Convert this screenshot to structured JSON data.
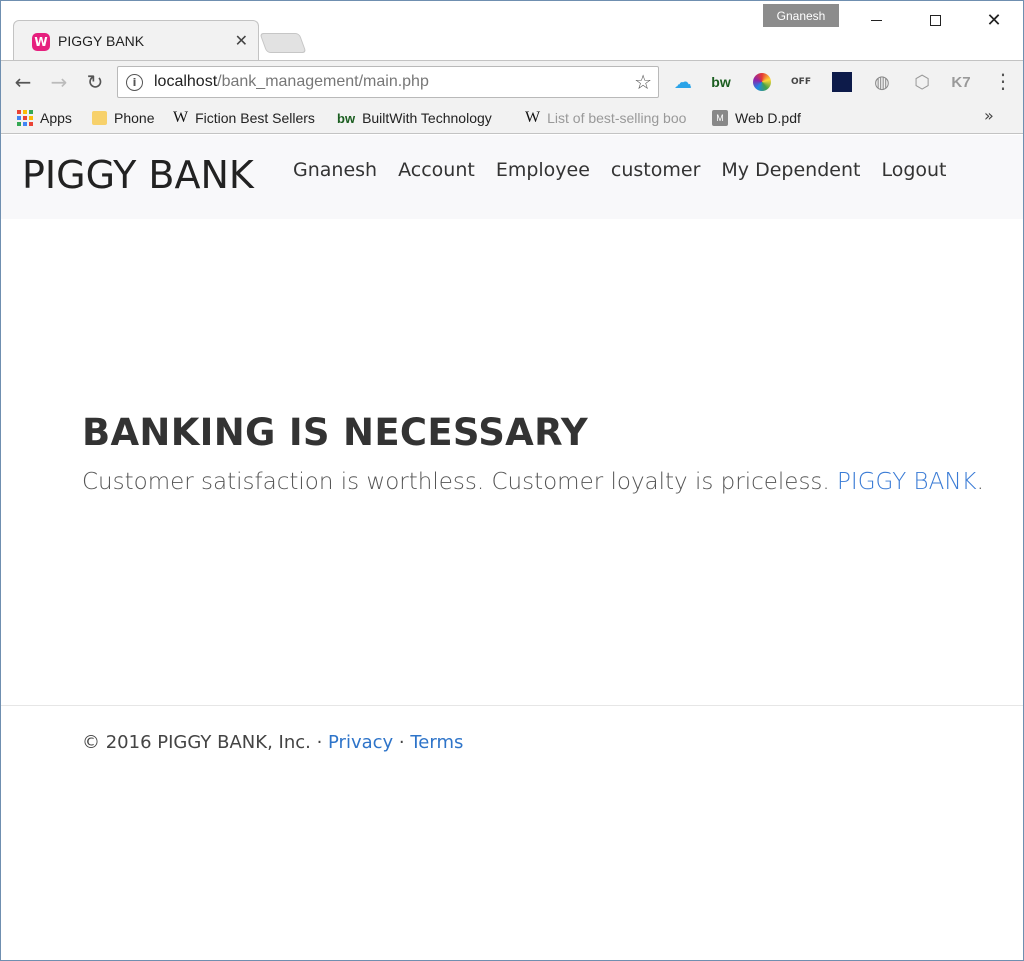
{
  "browser": {
    "tab_title": "PIGGY BANK",
    "profile_name": "Gnanesh",
    "url_host": "localhost",
    "url_path": "/bank_management/main.php",
    "extensions": {
      "bw": "bw",
      "off": "OFF",
      "k7": "K7"
    },
    "bookmarks": [
      {
        "label": "Apps"
      },
      {
        "label": "Phone"
      },
      {
        "label": "Fiction Best Sellers"
      },
      {
        "label": "BuiltWith Technology"
      },
      {
        "label": "List of best-selling boo"
      },
      {
        "label": "Web D.pdf"
      }
    ]
  },
  "site": {
    "brand": "PIGGY BANK",
    "nav": [
      {
        "label": "Gnanesh"
      },
      {
        "label": "Account"
      },
      {
        "label": "Employee"
      },
      {
        "label": "customer"
      },
      {
        "label": "My Dependent"
      },
      {
        "label": "Logout"
      }
    ],
    "hero": {
      "title": "BANKING IS NECESSARY",
      "subtitle_text": "Customer satisfaction is worthless. Customer loyalty is priceless. ",
      "subtitle_link": "PIGGY BANK",
      "subtitle_end": "."
    },
    "footer": {
      "copyright": "© 2016 PIGGY BANK, Inc. · ",
      "privacy": "Privacy",
      "separator": " · ",
      "terms": "Terms"
    }
  }
}
